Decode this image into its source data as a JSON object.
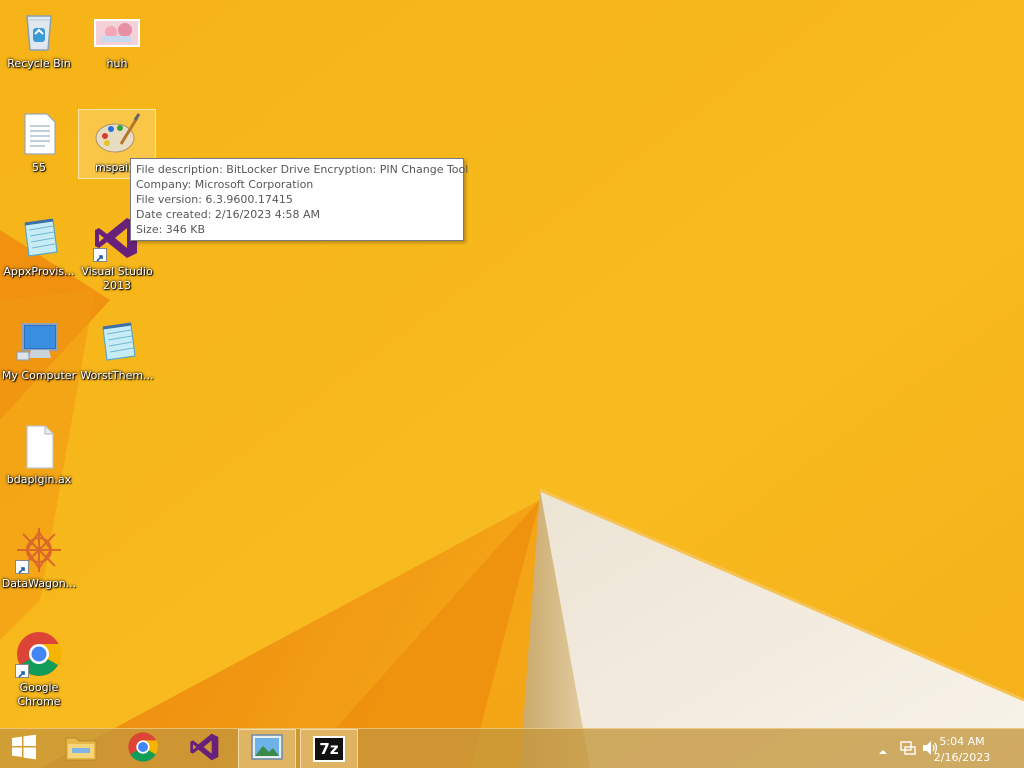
{
  "desktop": {
    "icons": [
      {
        "label": "Recycle Bin",
        "icon": "recycle-bin-icon"
      },
      {
        "label": "huh",
        "icon": "image-thumbnail-icon"
      },
      {
        "label": "55",
        "icon": "text-document-icon"
      },
      {
        "label": "mspaint",
        "icon": "paint-palette-icon"
      },
      {
        "label": "AppxProvis...",
        "icon": "notepad-icon"
      },
      {
        "label": "Visual Studio 2013",
        "icon": "visual-studio-icon"
      },
      {
        "label": "My Computer",
        "icon": "computer-icon"
      },
      {
        "label": "WorstThem...",
        "icon": "notepad-icon"
      },
      {
        "label": "bdaplgin.ax",
        "icon": "blank-file-icon"
      },
      {
        "label": "DataWagon...",
        "icon": "star-burst-icon"
      },
      {
        "label": "Google Chrome",
        "icon": "chrome-icon"
      }
    ]
  },
  "tooltip": {
    "description": "File description: BitLocker Drive Encryption: PIN Change Tool",
    "company": "Company: Microsoft Corporation",
    "version": "File version: 6.3.9600.17415",
    "created": "Date created: 2/16/2023 4:58 AM",
    "size": "Size: 346 KB"
  },
  "taskbar": {
    "buttons": [
      {
        "icon": "windows-start-icon"
      },
      {
        "icon": "file-explorer-icon"
      },
      {
        "icon": "chrome-icon"
      },
      {
        "icon": "visual-studio-icon"
      },
      {
        "icon": "photo-viewer-icon",
        "active": true
      },
      {
        "icon": "7zip-icon",
        "text": "7z",
        "active": true
      }
    ],
    "tray": {
      "icons": [
        "show-hidden-icons-icon",
        "network-icon",
        "volume-icon"
      ],
      "time": "5:04 AM",
      "date": "2/16/2023"
    }
  },
  "colors": {
    "wallpaper": "#f6b417",
    "wallpaper_dark": "#ec8a0b",
    "wallpaper_cream": "#f3ead8",
    "taskbar": "#c4963c",
    "vs_purple": "#68217a"
  }
}
